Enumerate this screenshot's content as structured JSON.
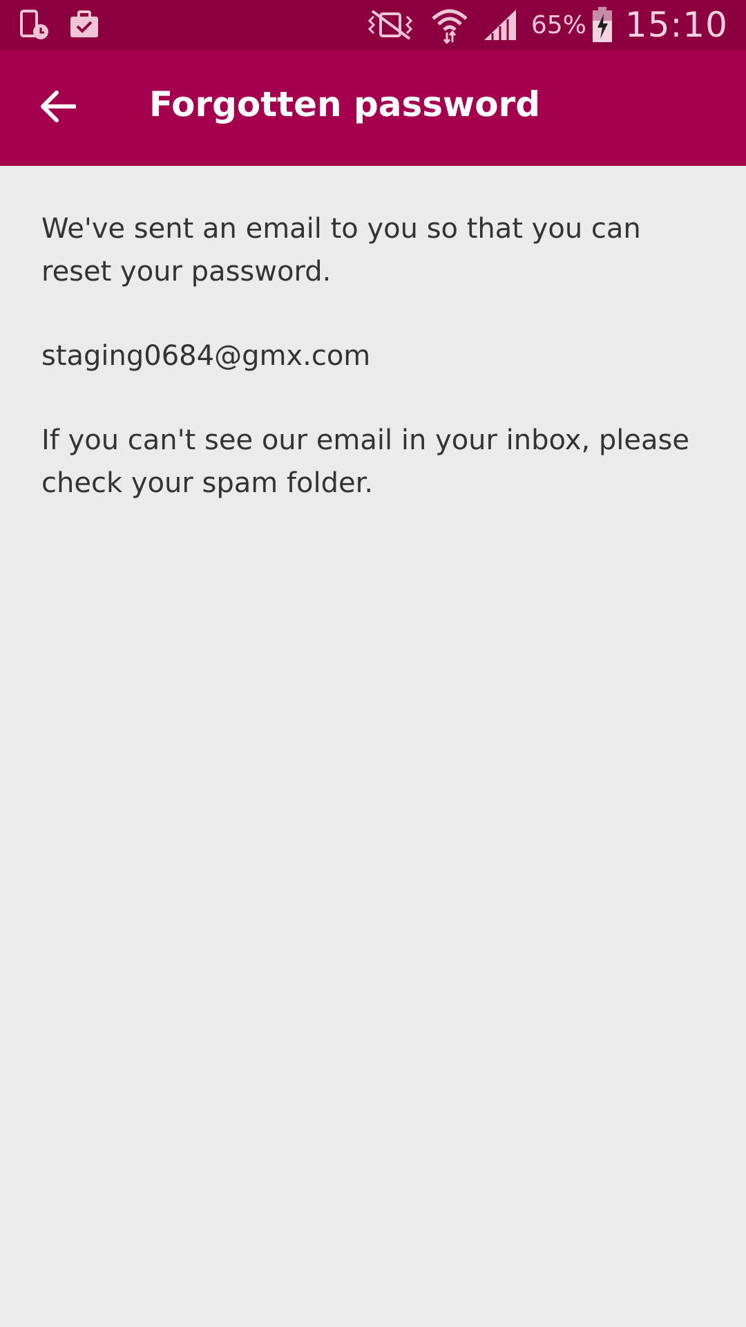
{
  "status_bar": {
    "battery_percent": "65%",
    "time": "15:10",
    "icons": [
      "device-clock-icon",
      "briefcase-check-icon",
      "vibrate-mute-icon",
      "wifi-icon",
      "signal-icon",
      "battery-charging-icon"
    ]
  },
  "app_bar": {
    "title": "Forgotten password",
    "back_icon": "arrow-back-icon"
  },
  "content": {
    "message_sent": "We've sent an email to you so that you can reset your password.",
    "email": "staging0684@gmx.com",
    "spam_hint": "If you can't see our email in your inbox, please check your spam folder."
  },
  "colors": {
    "status_bar": "#8c003f",
    "app_bar": "#a5004f",
    "background": "#ebebeb",
    "text": "#333333"
  }
}
